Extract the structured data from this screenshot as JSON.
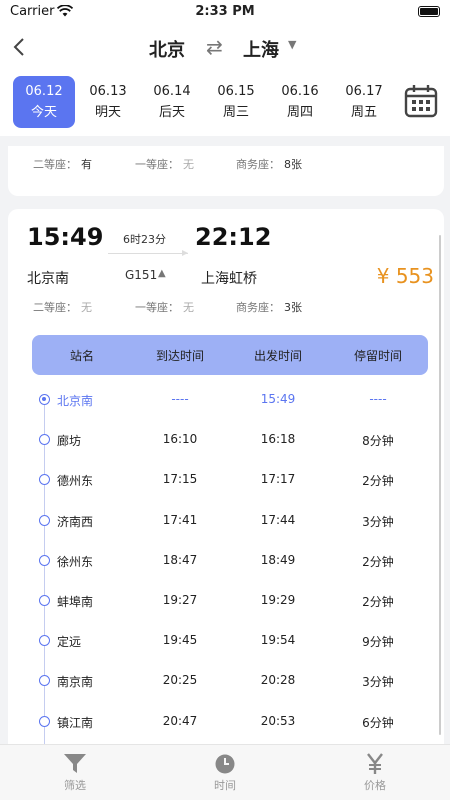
{
  "status": {
    "carrier": "Carrier",
    "time": "2:33 PM"
  },
  "nav": {
    "from": "北京",
    "swap_icon": "⇄",
    "to": "上海"
  },
  "dates": [
    {
      "date": "06.12",
      "label": "今天",
      "active": true
    },
    {
      "date": "06.13",
      "label": "明天",
      "active": false
    },
    {
      "date": "06.14",
      "label": "后天",
      "active": false
    },
    {
      "date": "06.15",
      "label": "周三",
      "active": false
    },
    {
      "date": "06.16",
      "label": "周四",
      "active": false
    },
    {
      "date": "06.17",
      "label": "周五",
      "active": false
    }
  ],
  "prev_card": {
    "seats": [
      {
        "label": "二等座：",
        "value": "有",
        "available": true
      },
      {
        "label": "一等座：",
        "value": "无",
        "available": false
      },
      {
        "label": "商务座：",
        "value": "8张",
        "available": true
      }
    ]
  },
  "train": {
    "depart_time": "15:49",
    "arrive_time": "22:12",
    "duration": "6时23分",
    "depart_station": "北京南",
    "train_no": "G151",
    "arrive_station": "上海虹桥",
    "price": "¥ 553",
    "seats": [
      {
        "label": "二等座：",
        "value": "无",
        "available": false
      },
      {
        "label": "一等座：",
        "value": "无",
        "available": false
      },
      {
        "label": "商务座：",
        "value": "3张",
        "available": true
      }
    ]
  },
  "table": {
    "headers": [
      "站名",
      "到达时间",
      "出发时间",
      "停留时间"
    ],
    "rows": [
      {
        "station": "北京南",
        "arrive": "----",
        "depart": "15:49",
        "stay": "----",
        "current": true
      },
      {
        "station": "廊坊",
        "arrive": "16:10",
        "depart": "16:18",
        "stay": "8分钟",
        "current": false
      },
      {
        "station": "德州东",
        "arrive": "17:15",
        "depart": "17:17",
        "stay": "2分钟",
        "current": false
      },
      {
        "station": "济南西",
        "arrive": "17:41",
        "depart": "17:44",
        "stay": "3分钟",
        "current": false
      },
      {
        "station": "徐州东",
        "arrive": "18:47",
        "depart": "18:49",
        "stay": "2分钟",
        "current": false
      },
      {
        "station": "蚌埠南",
        "arrive": "19:27",
        "depart": "19:29",
        "stay": "2分钟",
        "current": false
      },
      {
        "station": "定远",
        "arrive": "19:45",
        "depart": "19:54",
        "stay": "9分钟",
        "current": false
      },
      {
        "station": "南京南",
        "arrive": "20:25",
        "depart": "20:28",
        "stay": "3分钟",
        "current": false
      },
      {
        "station": "镇江南",
        "arrive": "20:47",
        "depart": "20:53",
        "stay": "6分钟",
        "current": false
      }
    ]
  },
  "tabs": [
    {
      "label": "筛选",
      "icon": "filter-icon"
    },
    {
      "label": "时间",
      "icon": "clock-icon"
    },
    {
      "label": "价格",
      "icon": "yuan-icon"
    }
  ],
  "colors": {
    "accent": "#5b75f0",
    "price": "#e8921f",
    "table_header": "#9db0f5"
  }
}
